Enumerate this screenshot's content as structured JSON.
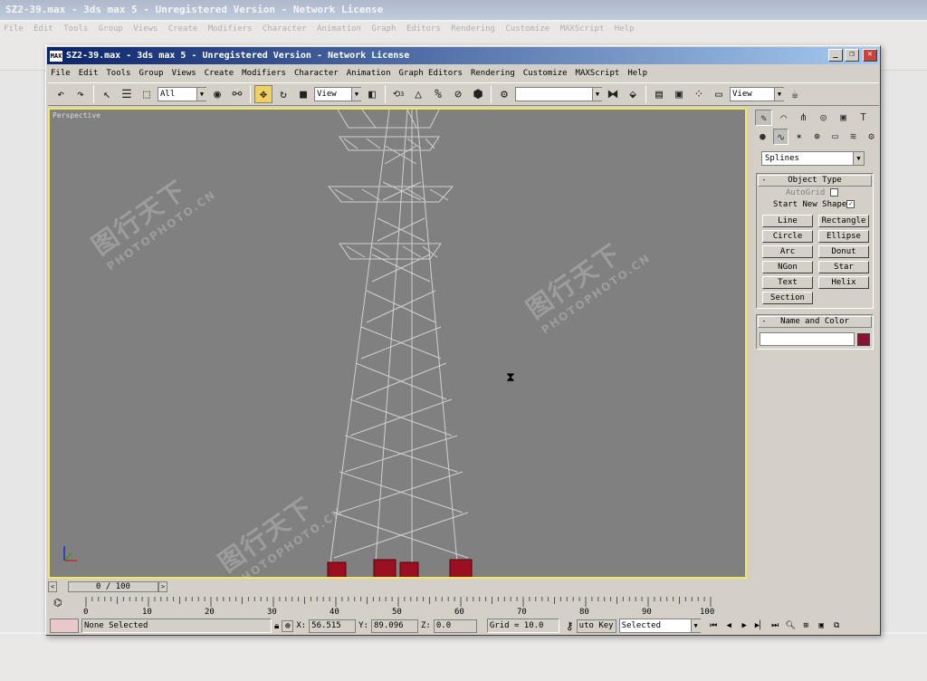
{
  "window": {
    "title": "SZ2-39.max - 3ds max 5 - Unregistered Version - Network License",
    "app_icon": "MAX"
  },
  "menu": [
    "File",
    "Edit",
    "Tools",
    "Group",
    "Views",
    "Create",
    "Modifiers",
    "Character",
    "Animation",
    "Graph Editors",
    "Rendering",
    "Customize",
    "MAXScript",
    "Help"
  ],
  "toolbar": {
    "selection_filter": "All",
    "ref_coord": "View",
    "named_sel": "",
    "render_type": "View",
    "snap_label": "3"
  },
  "viewport": {
    "label": "Perspective",
    "watermark_cn": "图行天下",
    "watermark_en": "PHOTOPHOTO.CN"
  },
  "command_panel": {
    "category": "Splines",
    "object_type_title": "Object Type",
    "autogrid_label": "AutoGrid",
    "start_new_shape_label": "Start New Shape",
    "start_new_shape_checked": "✓",
    "buttons": [
      "Line",
      "Rectangle",
      "Circle",
      "Ellipse",
      "Arc",
      "Donut",
      "NGon",
      "Star",
      "Text",
      "Helix",
      "Section"
    ],
    "name_color_title": "Name and Color",
    "object_color": "#8a1034"
  },
  "timeline": {
    "frame_display": "0 / 100",
    "ticks": [
      "0",
      "10",
      "20",
      "30",
      "40",
      "50",
      "60",
      "70",
      "80",
      "90",
      "100"
    ]
  },
  "status": {
    "selection": "None Selected",
    "x_label": "X:",
    "x_value": "56.515",
    "y_label": "Y:",
    "y_value": "89.096",
    "z_label": "Z:",
    "z_value": "0.0",
    "grid": "Grid = 10.0",
    "auto_key": "uto Key",
    "key_filter": "Selected"
  }
}
